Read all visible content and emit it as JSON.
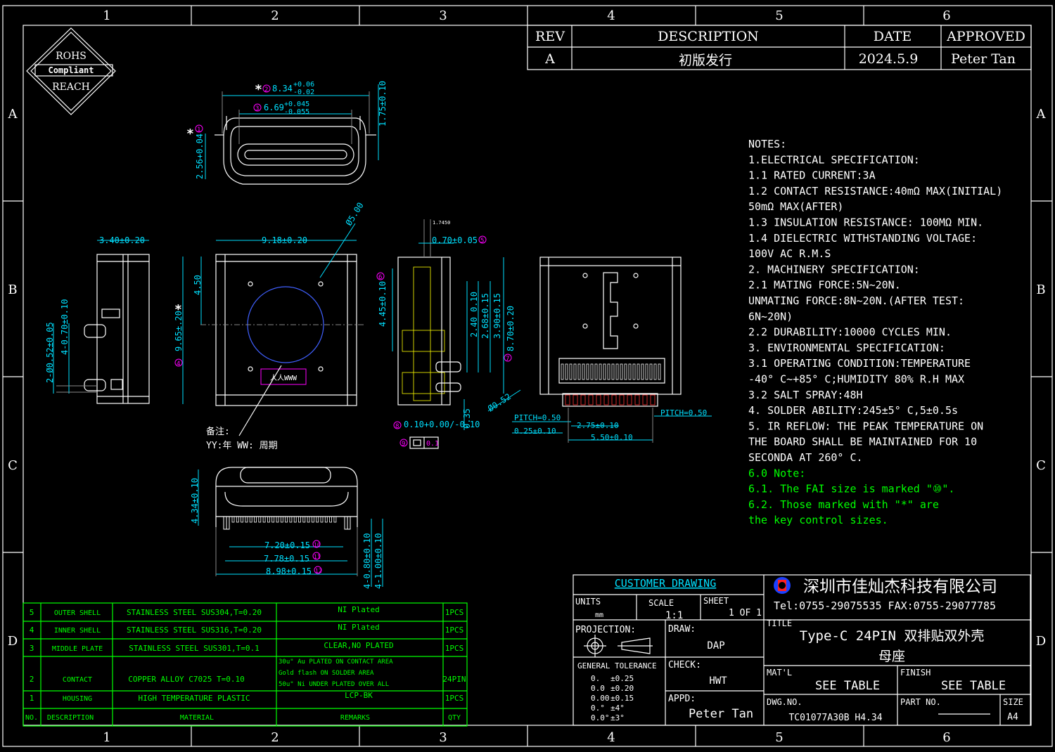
{
  "border": {
    "cols": [
      "1",
      "2",
      "3",
      "4",
      "5",
      "6"
    ],
    "rows": [
      "A",
      "B",
      "C",
      "D"
    ]
  },
  "rohs": {
    "l1": "ROHS",
    "l2": "Compliant",
    "l3": "REACH"
  },
  "revision": {
    "headers": [
      "REV",
      "DESCRIPTION",
      "DATE",
      "APPROVED"
    ],
    "row": [
      "A",
      "初版发行",
      "2024.5.9",
      "Peter Tan"
    ]
  },
  "notes": [
    {
      "t": "NOTES:",
      "c": "w"
    },
    {
      "t": "1.ELECTRICAL SPECIFICATION:",
      "c": "w"
    },
    {
      "t": "1.1 RATED CURRENT:3A",
      "c": "w"
    },
    {
      "t": "1.2 CONTACT RESISTANCE:40mΩ MAX(INITIAL)",
      "c": "w"
    },
    {
      "t": "    50mΩ MAX(AFTER)",
      "c": "w"
    },
    {
      "t": "1.3 INSULATION RESISTANCE: 100MΩ MIN.",
      "c": "w"
    },
    {
      "t": "1.4 DIELECTRIC WITHSTANDING VOLTAGE:",
      "c": "w"
    },
    {
      "t": "    100V AC R.M.S",
      "c": "w"
    },
    {
      "t": "2. MACHINERY SPECIFICATION:",
      "c": "w"
    },
    {
      "t": "2.1 MATING FORCE:5N~20N.",
      "c": "w"
    },
    {
      "t": "   UNMATING FORCE:8N~20N.(AFTER TEST:",
      "c": "w"
    },
    {
      "t": "   6N~20N)",
      "c": "w"
    },
    {
      "t": "2.2 DURABILITY:10000 CYCLES MIN.",
      "c": "w"
    },
    {
      "t": "3. ENVIRONMENTAL SPECIFICATION:",
      "c": "w"
    },
    {
      "t": "3.1 OPERATING CONDITION:TEMPERATURE",
      "c": "w"
    },
    {
      "t": "   -40° C~+85° C;HUMIDITY 80% R.H MAX",
      "c": "w"
    },
    {
      "t": "3.2 SALT SPRAY:48H",
      "c": "w"
    },
    {
      "t": "4. SOLDER ABILITY:245±5° C,5±0.5s",
      "c": "w"
    },
    {
      "t": "5. IR REFLOW: THE PEAK TEMPERATURE ON",
      "c": "w"
    },
    {
      "t": "   THE BOARD SHALL BE MAINTAINED FOR 10",
      "c": "w"
    },
    {
      "t": "   SECONDA AT 260° C.",
      "c": "w"
    },
    {
      "t": "6.0 Note:",
      "c": "g"
    },
    {
      "t": "6.1. The FAI size is marked \"⑩\".",
      "c": "g"
    },
    {
      "t": "6.2. Those marked with \"*\" are",
      "c": "g"
    },
    {
      "t": "     the key control sizes.",
      "c": "g"
    }
  ],
  "dims": {
    "d2": "8.34",
    "d2tol": "+0.06/-0.02",
    "d3": "6.69",
    "d3tol": "+0.045/-0.055",
    "d1": "2.56+0.04",
    "d175": "1.75±0.10",
    "w340": "3.40±0.20",
    "w918": "9.18±0.20",
    "dia": "Ø5.00",
    "v450": "4.50",
    "v965": "9.65±.20",
    "v052": "2-Ø0.52±0.05",
    "v070": "4-0.70±0.10",
    "s1745": "1.7450",
    "s070": "0.70±0.05",
    "s445": "4.45±0.10",
    "s240": "2.40 0.10",
    "s268": "2.68±0.15",
    "s390": "3.90±0.15",
    "s870": "8.70±0.20",
    "s010": "0.10+0.00/-0.10",
    "s035": "0.35",
    "s052": "Ø0.52",
    "p050a": "PITCH=0.50",
    "p050b": "PITCH=0.50",
    "p025": "0.25±0.10",
    "p275": "2.75±0.10",
    "p550": "5.50±0.10",
    "b434": "4.34±0.10",
    "b720": "7.20±0.15",
    "b778": "7.78±0.15",
    "b898": "8.98±0.15",
    "b080": "4-0.80±0.10",
    "b100": "4-1.00±0.10",
    "flat": "0.1",
    "memo1": "备注:",
    "memo2": "YY:年 WW: 周期",
    "mark": "人人WWW"
  },
  "bom": {
    "rows": [
      [
        "5",
        "OUTER SHELL",
        "STAINLESS STEEL SUS304,T=0.20",
        "NI Plated",
        "1PCS"
      ],
      [
        "4",
        "INNER SHELL",
        "STAINLESS STEEL SUS316,T=0.20",
        "NI Plated",
        "1PCS"
      ],
      [
        "3",
        "MIDDLE PLATE",
        "STAINLESS STEEL SUS301,T=0.1",
        "CLEAR,NO PLATED",
        "1PCS"
      ],
      [
        "2",
        "CONTACT",
        "COPPER ALLOY C7025 T=0.10",
        "30u\" Au PLATED ON CONTACT AREA|Gold flash ON SOLDER AREA|50u\" Ni UNDER PLATED OVER ALL",
        "24PIN"
      ],
      [
        "1",
        "HOUSING",
        "HIGH TEMPERATURE PLASTIC",
        "LCP-BK",
        "1PCS"
      ]
    ],
    "header": [
      "NO.",
      "DESCRIPTION",
      "MATERIAL",
      "REMARKS",
      "QTY"
    ]
  },
  "title": {
    "customer": "CUSTOMER DRAWING",
    "company": "深圳市佳灿杰科技有限公司",
    "tel": "Tel:0755-29075535 FAX:0755-29077785",
    "units_l": "UNITS",
    "units_v": "mm",
    "scale_l": "SCALE",
    "scale_v": "1:1",
    "sheet_l": "SHEET",
    "sheet_v": "1 OF 1",
    "title_l": "TITLE",
    "title_v1": "Type-C 24PIN 双排贴双外壳",
    "title_v2": "母座",
    "proj_l": "PROJECTION:",
    "draw_l": "DRAW:",
    "draw_v": "DAP",
    "check_l": "CHECK:",
    "check_v": "HWT",
    "appd_l": "APPD:",
    "appd_v": "Peter Tan",
    "gt_l": "GENERAL TOLERANCE",
    "gt": [
      [
        "0.",
        "±0.25"
      ],
      [
        "0.0",
        "±0.20"
      ],
      [
        "0.00",
        "±0.15"
      ],
      [
        "0.°",
        "±4°"
      ],
      [
        "0.0°",
        "±3°"
      ]
    ],
    "mat_l": "MAT'L",
    "mat_v": "SEE TABLE",
    "fin_l": "FINISH",
    "fin_v": "SEE TABLE",
    "dwg_l": "DWG.NO.",
    "dwg_v": "TC01077A30B H4.34",
    "part_l": "PART NO.",
    "size_l": "SIZE",
    "size_v": "A4"
  }
}
